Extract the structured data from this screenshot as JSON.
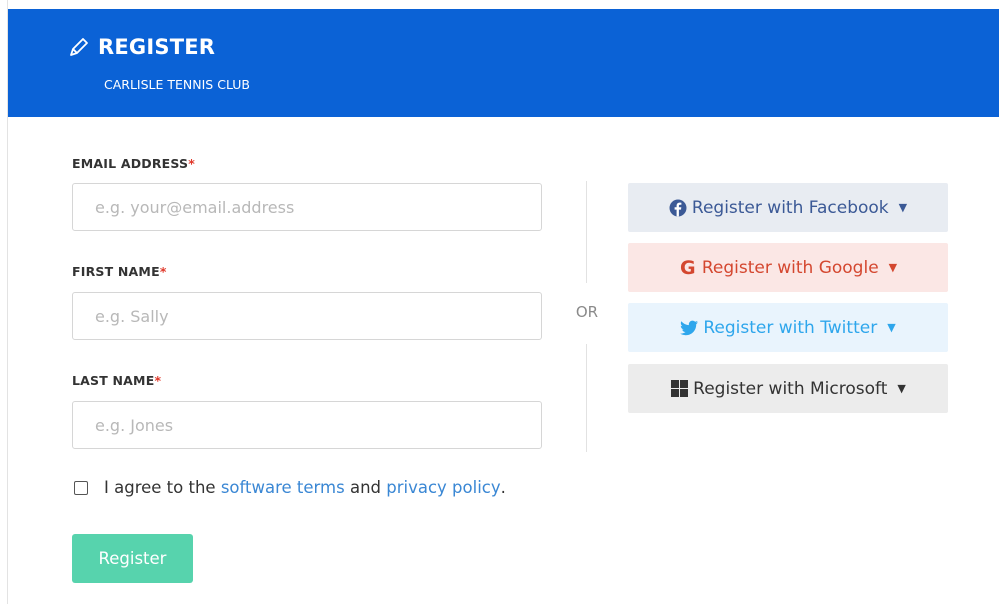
{
  "header": {
    "title": "REGISTER",
    "subtitle": "CARLISLE TENNIS CLUB",
    "icon": "pencil-icon"
  },
  "form": {
    "required_mark": "*",
    "email": {
      "label": "EMAIL ADDRESS",
      "placeholder": "e.g. your@email.address",
      "value": ""
    },
    "first_name": {
      "label": "FIRST NAME",
      "placeholder": "e.g. Sally",
      "value": ""
    },
    "last_name": {
      "label": "LAST NAME",
      "placeholder": "e.g. Jones",
      "value": ""
    },
    "agree": {
      "prefix": "I agree to the",
      "terms_link": "software terms",
      "middle": "and",
      "privacy_link": "privacy policy",
      "suffix": ".",
      "checked": false
    },
    "submit_label": "Register"
  },
  "divider": {
    "label": "OR"
  },
  "social": [
    {
      "label": "Register with Facebook",
      "icon": "facebook-icon",
      "color": "#3b5996"
    },
    {
      "label": "Register with Google",
      "icon": "google-icon",
      "color": "#d4472f"
    },
    {
      "label": "Register with Twitter",
      "icon": "twitter-icon",
      "color": "#2ea6ec"
    },
    {
      "label": "Register with Microsoft",
      "icon": "microsoft-icon",
      "color": "#333333"
    }
  ],
  "colors": {
    "header_bg": "#0b62d6",
    "register_button": "#57d3ad",
    "link": "#3a87d4",
    "required": "#e0392b"
  }
}
